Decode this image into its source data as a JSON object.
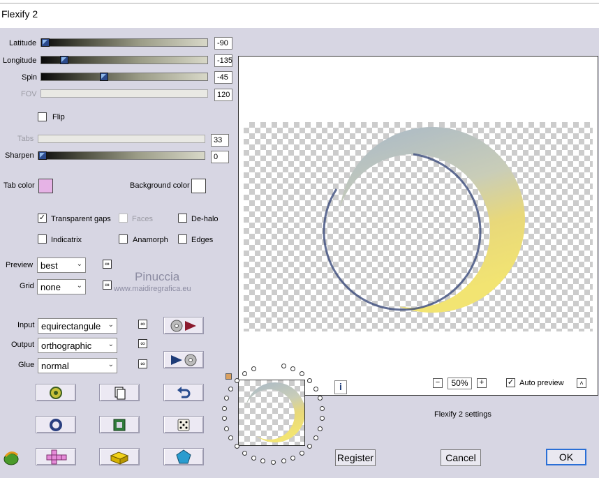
{
  "window": {
    "title": "Flexify 2"
  },
  "sliders": [
    {
      "label": "Latitude",
      "value": "-90",
      "fraction": 0.0,
      "enabled": true
    },
    {
      "label": "Longitude",
      "value": "-135",
      "fraction": 0.12,
      "enabled": true
    },
    {
      "label": "Spin",
      "value": "-45",
      "fraction": 0.37,
      "enabled": true
    },
    {
      "label": "FOV",
      "value": "120",
      "fraction": null,
      "enabled": false
    }
  ],
  "flip_label": "Flip",
  "tabs": {
    "label": "Tabs",
    "value": "33",
    "enabled": false
  },
  "sharpen": {
    "label": "Sharpen",
    "value": "0",
    "fraction": 0.0
  },
  "colors": {
    "tab_label": "Tab color",
    "tab_color": "#e6b3e6",
    "background_label": "Background color",
    "background_color": "#ffffff"
  },
  "options": {
    "transparent_gaps": {
      "label": "Transparent gaps",
      "checked": true
    },
    "faces": {
      "label": "Faces",
      "checked": false,
      "enabled": false
    },
    "dehalo": {
      "label": "De-halo",
      "checked": false
    },
    "indicatrix": {
      "label": "Indicatrix",
      "checked": false
    },
    "anamorph": {
      "label": "Anamorph",
      "checked": false
    },
    "edges": {
      "label": "Edges",
      "checked": false
    }
  },
  "preview_quality": {
    "label": "Preview",
    "value": "best"
  },
  "grid": {
    "label": "Grid",
    "value": "none"
  },
  "watermark": {
    "line1": "Pinuccia",
    "line2": "www.maidiregrafica.eu"
  },
  "input": {
    "label": "Input",
    "value": "equirectangule"
  },
  "output": {
    "label": "Output",
    "value": "orthographic"
  },
  "glue": {
    "label": "Glue",
    "value": "normal"
  },
  "zoom": {
    "minus": "−",
    "value": "50%",
    "plus": "+"
  },
  "auto_preview": {
    "label": "Auto preview",
    "checked": true
  },
  "settings_label": "Flexify 2 settings",
  "buttons": {
    "register": "Register",
    "cancel": "Cancel",
    "ok": "OK"
  },
  "icons": {
    "latlong_link": "link-icon",
    "preview_mini_icon": "info-icon",
    "toolbar": [
      "randomize-globe-icon",
      "copy-icon",
      "undo-icon",
      "ring-icon",
      "square-icon",
      "dice-icon",
      "plus-net-icon",
      "lego-brick-icon",
      "pentagon-icon"
    ],
    "filter_logo": "flexify-logo-icon"
  }
}
